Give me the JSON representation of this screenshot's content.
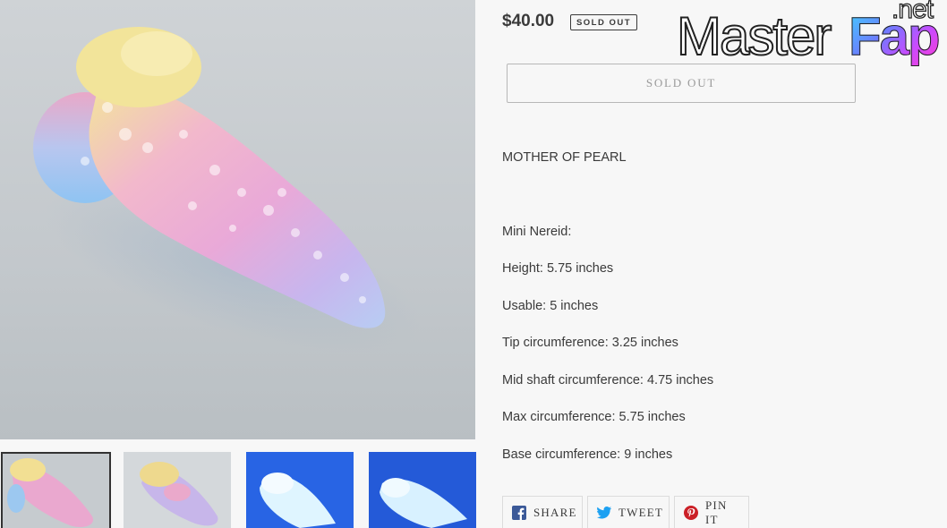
{
  "product": {
    "price": "$40.00",
    "badge": "SOLD OUT",
    "button_label": "SOLD OUT"
  },
  "description": {
    "title": "MOTHER OF PEARL",
    "lines": [
      "Mini Nereid:",
      "Height: 5.75 inches",
      "Usable: 5 inches",
      "Tip circumference: 3.25 inches",
      "Mid shaft circumference: 4.75 inches",
      "Max circumference: 5.75 inches",
      "Base circumference: 9 inches"
    ]
  },
  "social": {
    "share": "SHARE",
    "tweet": "TWEET",
    "pin": "PIN IT"
  },
  "watermark": {
    "part1": "Master",
    "part2": "Fap",
    "part3": ".net"
  },
  "gallery": {
    "thumbnail_count": 4,
    "active_index": 0
  },
  "colors": {
    "text": "#3a3a3a",
    "background": "#f7f7f7",
    "facebook": "#3b5998",
    "twitter": "#1da1f2",
    "pinterest": "#cb2027"
  },
  "icons": [
    "facebook-icon",
    "twitter-icon",
    "pinterest-icon"
  ]
}
